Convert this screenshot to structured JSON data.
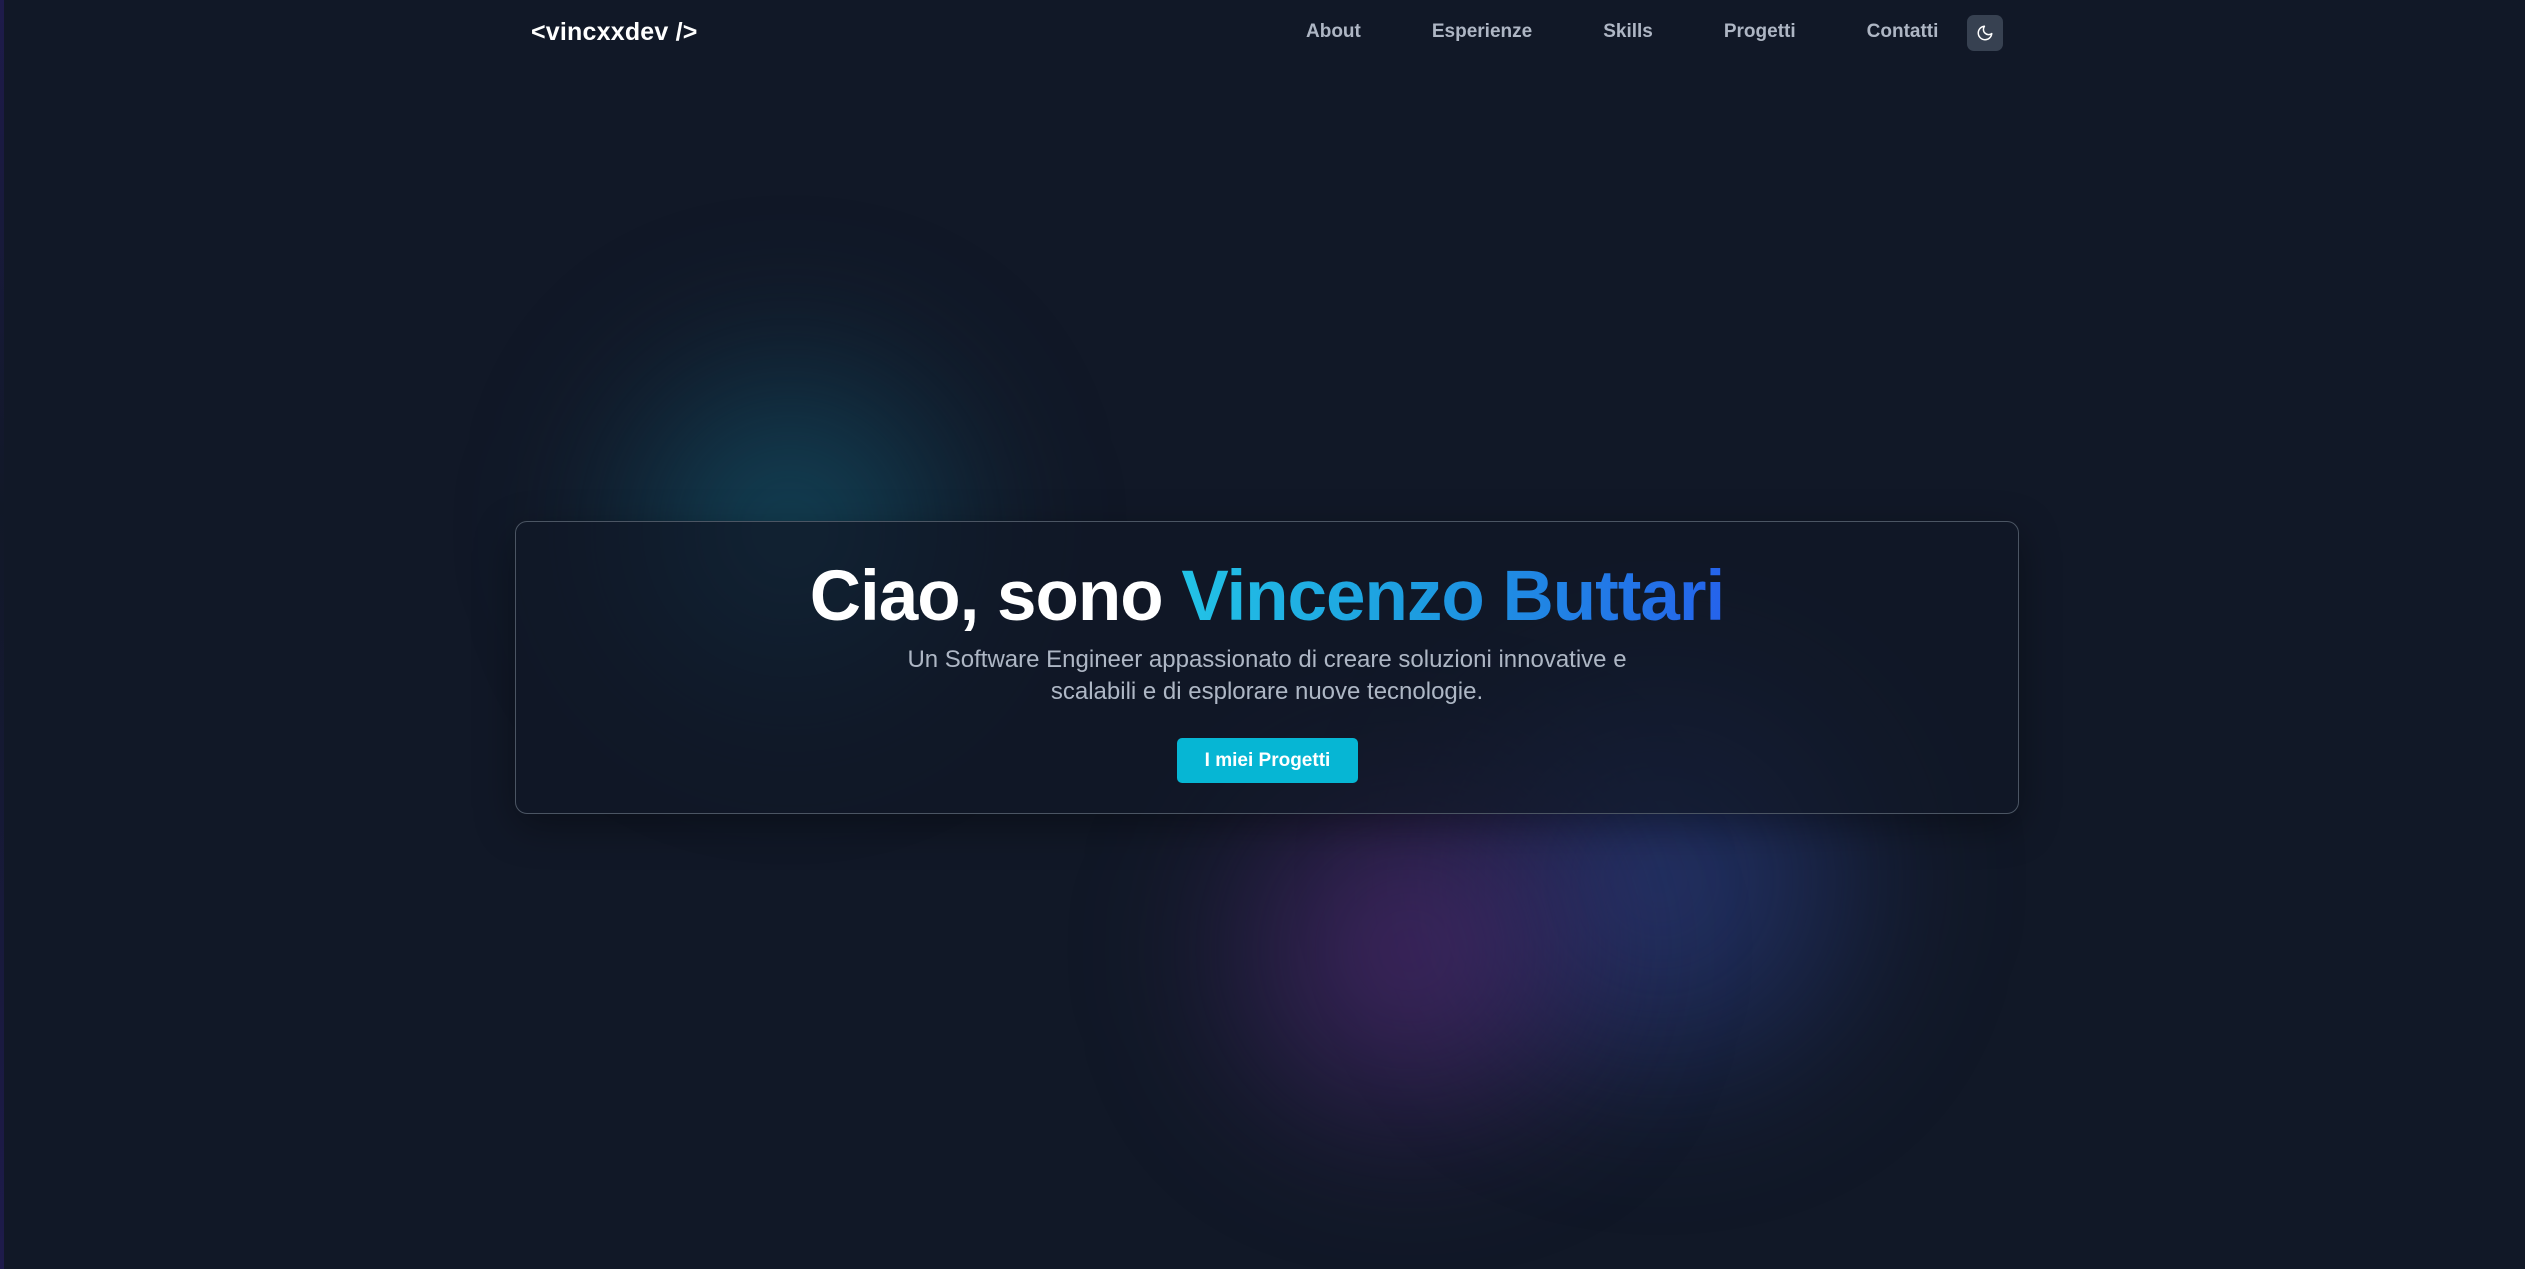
{
  "header": {
    "logo": "<vincxxdev />",
    "nav": [
      "About",
      "Esperienze",
      "Skills",
      "Progetti",
      "Contatti"
    ],
    "theme_toggle_icon": "moon-icon"
  },
  "hero": {
    "greeting": "Ciao, sono",
    "name": "Vincenzo Buttari",
    "subtitle_line1": "Un Software Engineer appassionato di creare soluzioni innovative e",
    "subtitle_line2": "scalabili e di esplorare nuove tecnologie.",
    "cta_label": "I miei Progetti"
  },
  "colors": {
    "background": "#111827",
    "accent": "#06b6d4",
    "gradient_start": "#22d3ee",
    "gradient_end": "#2563eb"
  }
}
